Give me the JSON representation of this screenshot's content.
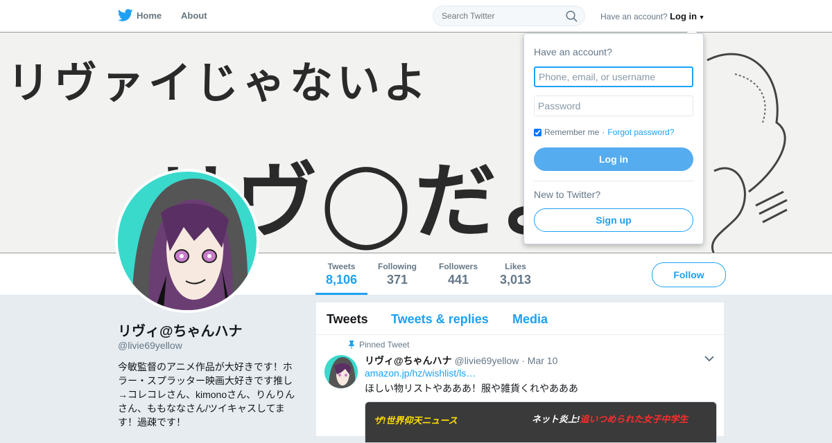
{
  "topbar": {
    "home_label": "Home",
    "about_label": "About",
    "search_placeholder": "Search Twitter",
    "have_account": "Have an account?",
    "login_label": "Log in"
  },
  "banner": {
    "line1": "リヴァイじゃないよ",
    "line2": "リヴ◯だよ!!"
  },
  "profile": {
    "name": "リヴィ@ちゃんハナ",
    "handle": "@livie69yellow",
    "bio": "今敏監督のアニメ作品が大好きです！ホラー・スプラッター映画大好きです推し→コレコレさん、kimonoさん、りんりんさん、ももななさん/ツイキャスしてます！過疎です！",
    "follow_label": "Follow"
  },
  "stats": [
    {
      "label": "Tweets",
      "value": "8,106",
      "active": true
    },
    {
      "label": "Following",
      "value": "371",
      "active": false
    },
    {
      "label": "Followers",
      "value": "441",
      "active": false
    },
    {
      "label": "Likes",
      "value": "3,013",
      "active": false
    }
  ],
  "timeline": {
    "tabs": [
      "Tweets",
      "Tweets & replies",
      "Media"
    ],
    "pinned_label": "Pinned Tweet",
    "tweet": {
      "name": "リヴィ@ちゃんハナ",
      "handle": "@livie69yellow",
      "date": "· Mar 10",
      "link": "amazon.jp/hz/wishlist/ls…",
      "text": "ほしい物リストやあああ！服や雑貨くれやあああ",
      "media_left": "ザ!世界仰天ニュース",
      "media_right_prefix": "ネット炎上!",
      "media_right_highlight": "追いつめられた女子中学生"
    }
  },
  "login_dropdown": {
    "title": "Have an account?",
    "username_placeholder": "Phone, email, or username",
    "password_placeholder": "Password",
    "remember_label": "Remember me",
    "separator": "·",
    "forgot_label": "Forgot password?",
    "login_button": "Log in",
    "new_to": "New to Twitter?",
    "signup_button": "Sign up"
  },
  "colors": {
    "accent": "#1da1f2",
    "login_button": "#55acee",
    "avatar_bg": "#39d9cc"
  }
}
